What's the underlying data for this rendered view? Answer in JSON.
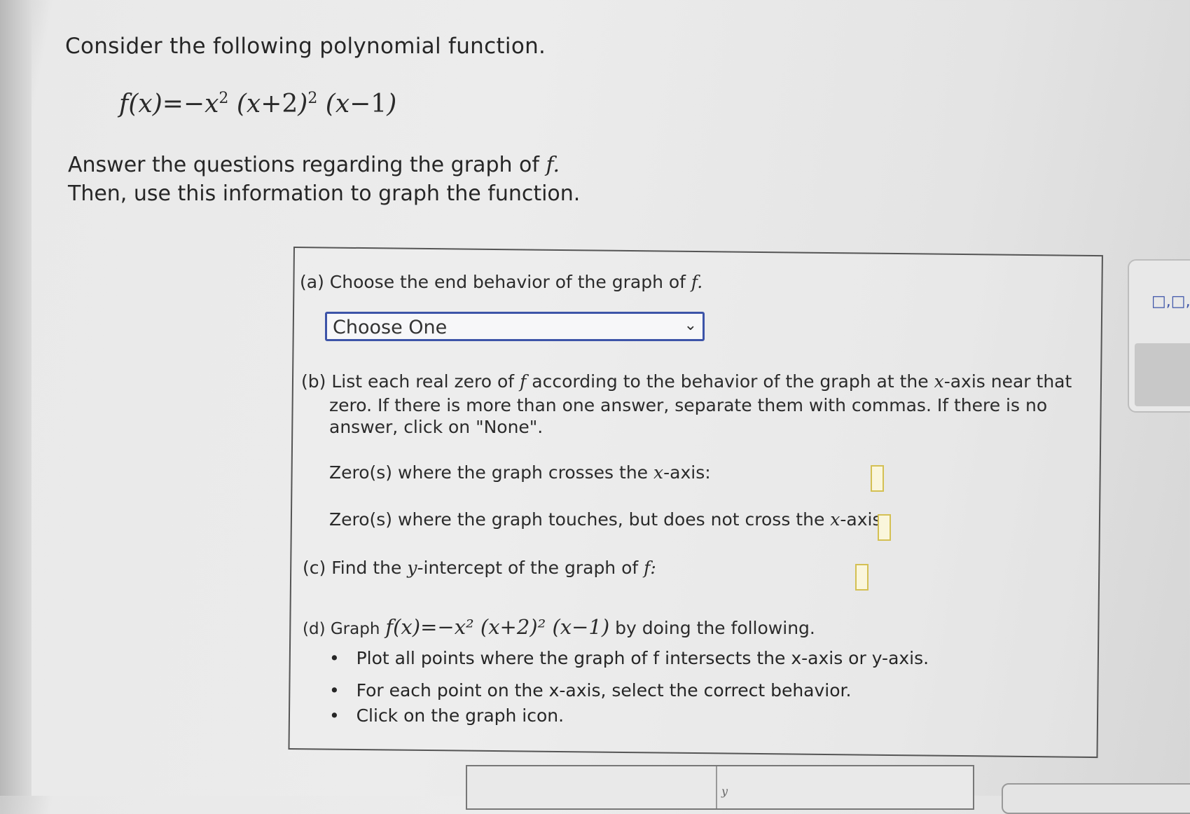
{
  "intro": "Consider the following polynomial function.",
  "formula": {
    "lhs": "f",
    "x": "x",
    "eq": "=−",
    "sq": "2",
    "plus2": "+2",
    "minus1": "−1"
  },
  "instructions": {
    "line1": "Answer the questions regarding the graph of",
    "line1_f": "f.",
    "line2": "Then, use this information to graph the function."
  },
  "part_a": {
    "label": "(a) Choose the end behavior of the graph of",
    "f": "f.",
    "select_value": "Choose One"
  },
  "part_b": {
    "line1a": "(b) List each real zero of",
    "line1_f": "f",
    "line1b": "according to the behavior of the graph at the",
    "line1_x": "x",
    "line1c": "-axis near that",
    "line2": "zero. If there is more than one answer, separate them with commas. If there is no",
    "line3": "answer, click on \"None\".",
    "crosses_a": "Zero(s) where the graph crosses the",
    "crosses_x": "x",
    "crosses_b": "-axis:",
    "touches_a": "Zero(s) where the graph touches, but does not cross the",
    "touches_x": "x",
    "touches_b": "-axis:"
  },
  "part_c": {
    "label_a": "(c) Find the",
    "label_y": "y",
    "label_b": "-intercept of the graph of",
    "f": "f:"
  },
  "part_d": {
    "label": "(d) Graph",
    "formula": "f(x)=−x² (x+2)² (x−1)",
    "label_b": "by doing the following.",
    "bullets": [
      "Plot all points where the graph of f intersects the x-axis or y-axis.",
      "For each point on the x-axis, select the correct behavior.",
      "Click on the graph icon."
    ]
  },
  "right_panel_icon": "□,□,",
  "graph_axis_label": "y"
}
